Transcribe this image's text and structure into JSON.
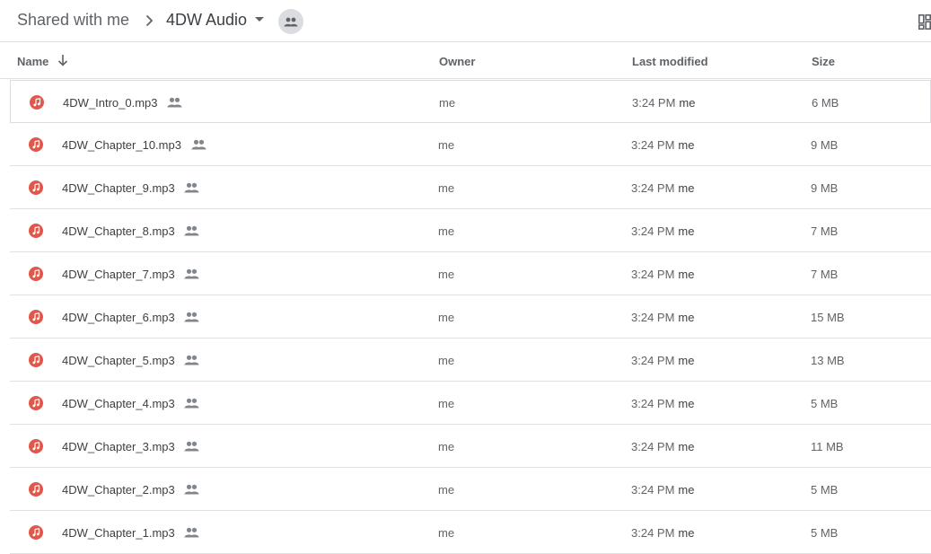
{
  "breadcrumb": {
    "root": "Shared with me",
    "current": "4DW Audio"
  },
  "icons": {
    "separator": "chevron-right-icon",
    "caret": "caret-down-icon",
    "shared_folder": "people-icon",
    "view_toggle": "grid-view-icon",
    "sort": "arrow-down-icon",
    "file": "audio-file-icon"
  },
  "columns": {
    "name": "Name",
    "owner": "Owner",
    "last_modified": "Last modified",
    "size": "Size"
  },
  "colors": {
    "audio_icon": "#e2574c",
    "text_secondary": "#5f6368",
    "divider": "#e0e0e0"
  },
  "files": [
    {
      "name": "4DW_Intro_0.mp3",
      "owner": "me",
      "modified_time": "3:24 PM",
      "modified_by": "me",
      "size": "6 MB"
    },
    {
      "name": "4DW_Chapter_10.mp3",
      "owner": "me",
      "modified_time": "3:24 PM",
      "modified_by": "me",
      "size": "9 MB"
    },
    {
      "name": "4DW_Chapter_9.mp3",
      "owner": "me",
      "modified_time": "3:24 PM",
      "modified_by": "me",
      "size": "9 MB"
    },
    {
      "name": "4DW_Chapter_8.mp3",
      "owner": "me",
      "modified_time": "3:24 PM",
      "modified_by": "me",
      "size": "7 MB"
    },
    {
      "name": "4DW_Chapter_7.mp3",
      "owner": "me",
      "modified_time": "3:24 PM",
      "modified_by": "me",
      "size": "7 MB"
    },
    {
      "name": "4DW_Chapter_6.mp3",
      "owner": "me",
      "modified_time": "3:24 PM",
      "modified_by": "me",
      "size": "15 MB"
    },
    {
      "name": "4DW_Chapter_5.mp3",
      "owner": "me",
      "modified_time": "3:24 PM",
      "modified_by": "me",
      "size": "13 MB"
    },
    {
      "name": "4DW_Chapter_4.mp3",
      "owner": "me",
      "modified_time": "3:24 PM",
      "modified_by": "me",
      "size": "5 MB"
    },
    {
      "name": "4DW_Chapter_3.mp3",
      "owner": "me",
      "modified_time": "3:24 PM",
      "modified_by": "me",
      "size": "11 MB"
    },
    {
      "name": "4DW_Chapter_2.mp3",
      "owner": "me",
      "modified_time": "3:24 PM",
      "modified_by": "me",
      "size": "5 MB"
    },
    {
      "name": "4DW_Chapter_1.mp3",
      "owner": "me",
      "modified_time": "3:24 PM",
      "modified_by": "me",
      "size": "5 MB"
    }
  ]
}
